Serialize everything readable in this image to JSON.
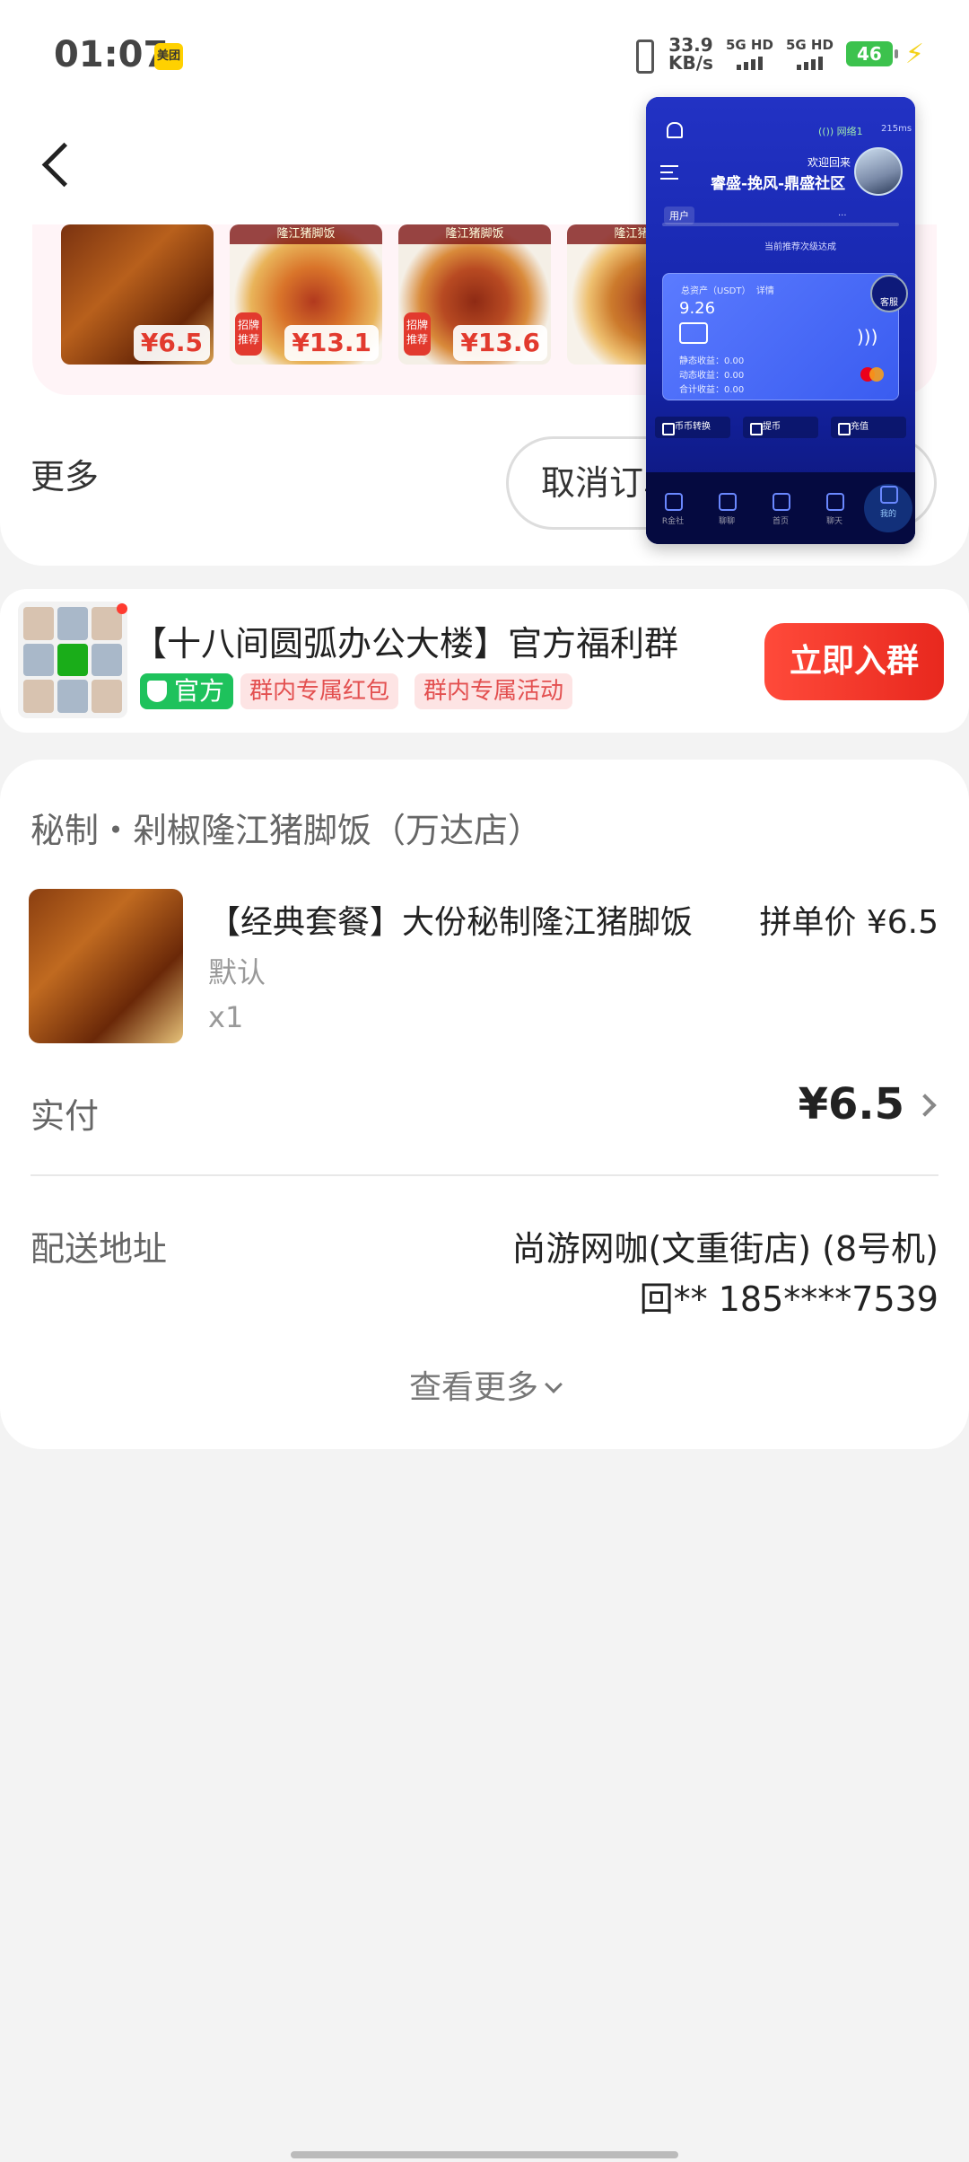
{
  "status_bar": {
    "time": "01:07",
    "app_badge": "美团",
    "net_speed": "33.9",
    "net_unit": "KB/s",
    "sim1": "5G HD",
    "sim2": "5G HD",
    "battery": "46"
  },
  "products_strip": [
    {
      "price": "¥6.5"
    },
    {
      "price": "¥13.1"
    },
    {
      "price": "¥13.6"
    },
    {
      "price": ""
    }
  ],
  "strip_banner": "隆江猪脚饭",
  "strip_tag": "招牌推荐",
  "more": {
    "label": "更多",
    "cancel_button": "取消订单"
  },
  "overlay": {
    "node": "(()) 网络1",
    "ms": "215ms",
    "welcome": "欢迎回来",
    "community": "睿盛-挽风-鼎盛社区",
    "user_label": "用户",
    "next_level_text": "当前推荐次级达成",
    "progress_text": "...",
    "card_label": "总资产（USDT）",
    "card_sub": "详情",
    "balance": "9.26",
    "static_income": "静态收益：0.00",
    "dynamic_income": "动态收益：0.00",
    "total_income": "合计收益：0.00",
    "kefu": "客服",
    "actions": [
      "币币转换",
      "提币",
      "充值"
    ],
    "nav": [
      "R金社",
      "聊聊",
      "首页",
      "聊天",
      "我的"
    ]
  },
  "group": {
    "title": "【十八间圆弧办公大楼】官方福利群",
    "official": "官方",
    "tag1": "群内专属红包",
    "tag2": "群内专属活动",
    "join_button": "立即入群"
  },
  "order": {
    "shop_name": "秘制・剁椒隆江猪脚饭（万达店）",
    "item_name": "【经典套餐】大份秘制隆江猪脚饭",
    "item_price": "拼单价 ¥6.5",
    "item_spec": "默认",
    "item_qty": "x1",
    "paid_label": "实付",
    "paid_value": "¥6.5",
    "address_label": "配送地址",
    "address_line1": "尚游网咖(文重街店) (8号机)",
    "address_line2": "回** 185****7539",
    "see_more": "查看更多"
  }
}
